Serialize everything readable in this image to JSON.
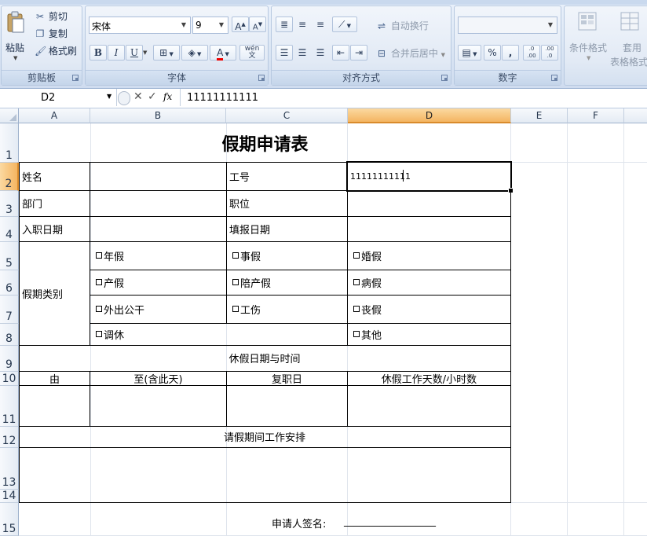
{
  "ribbon": {
    "clipboard": {
      "paste": "粘贴",
      "cut": "剪切",
      "copy": "复制",
      "format_painter": "格式刷",
      "group": "剪贴板"
    },
    "font": {
      "name": "宋体",
      "size": "9",
      "group": "字体",
      "bold": "B",
      "italic": "I",
      "underline": "U",
      "grow": "A",
      "shrink": "A",
      "color": "A",
      "phonetic": "wén 文"
    },
    "alignment": {
      "wrap": "自动换行",
      "merge": "合并后居中",
      "group": "对齐方式"
    },
    "number": {
      "format": "",
      "percent": "%",
      "comma": ",",
      "inc_decimal": ".0 .00",
      "dec_decimal": ".00 .0",
      "group": "数字"
    },
    "styles": {
      "conditional": "条件格式",
      "table_line1": "套用",
      "table_line2": "表格格式"
    }
  },
  "formula_bar": {
    "name_box": "D2",
    "fx": "fx",
    "value": "11111111111"
  },
  "columns": [
    "A",
    "B",
    "C",
    "D",
    "E",
    "F"
  ],
  "rows": [
    "1",
    "2",
    "3",
    "4",
    "5",
    "6",
    "7",
    "8",
    "9",
    "10",
    "11",
    "12",
    "13",
    "14",
    "15"
  ],
  "sheet": {
    "title": "假期申请表",
    "name_label": "姓名",
    "emp_no_label": "工号",
    "emp_no_value": "11111111111",
    "dept_label": "部门",
    "position_label": "职位",
    "hire_date_label": "入职日期",
    "fill_date_label": "填报日期",
    "leave_type_label": "假期类别",
    "leave_types": [
      "年假",
      "事假",
      "婚假",
      "产假",
      "陪产假",
      "病假",
      "外出公干",
      "工伤",
      "丧假",
      "调休",
      "其他"
    ],
    "dates_header": "休假日期与时间",
    "col_from": "由",
    "col_to": "至(含此天)",
    "col_return": "复职日",
    "col_days": "休假工作天数/小时数",
    "work_arrangement": "请假期间工作安排",
    "signature_label": "申请人签名:",
    "signature_line": "__________________"
  }
}
